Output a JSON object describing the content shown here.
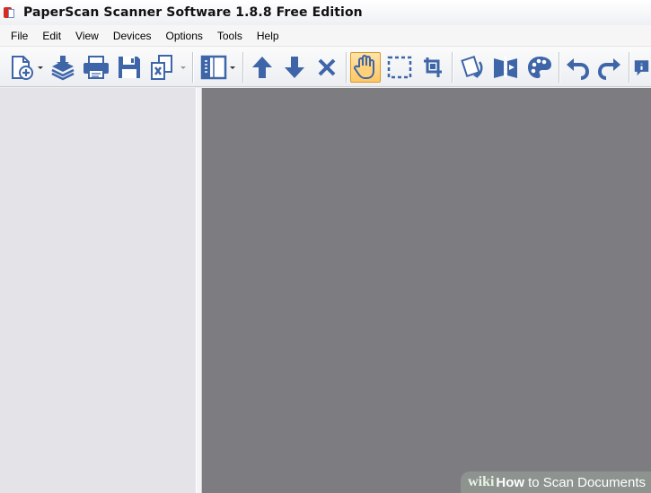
{
  "window": {
    "title": "PaperScan Scanner Software 1.8.8 Free Edition"
  },
  "menu": {
    "items": [
      "File",
      "Edit",
      "View",
      "Devices",
      "Options",
      "Tools",
      "Help"
    ]
  },
  "toolbar": {
    "buttons": [
      {
        "icon": "new-page-icon"
      },
      {
        "icon": "acquire-icon"
      },
      {
        "icon": "print-icon"
      },
      {
        "icon": "save-icon"
      },
      {
        "icon": "export-icon"
      },
      {
        "icon": "layout-icon"
      },
      {
        "icon": "arrow-up-icon"
      },
      {
        "icon": "arrow-down-icon"
      },
      {
        "icon": "delete-icon"
      },
      {
        "icon": "hand-icon",
        "active": true
      },
      {
        "icon": "select-icon"
      },
      {
        "icon": "crop-icon"
      },
      {
        "icon": "rotate-icon"
      },
      {
        "icon": "mirror-icon"
      },
      {
        "icon": "palette-icon"
      },
      {
        "icon": "undo-icon"
      },
      {
        "icon": "redo-icon"
      },
      {
        "icon": "info-icon"
      }
    ],
    "accent_color": "#3d65a8",
    "active_color": "#ffc765"
  },
  "watermark": {
    "brand": "wiki",
    "how": "How",
    "rest": "to Scan Documents"
  }
}
